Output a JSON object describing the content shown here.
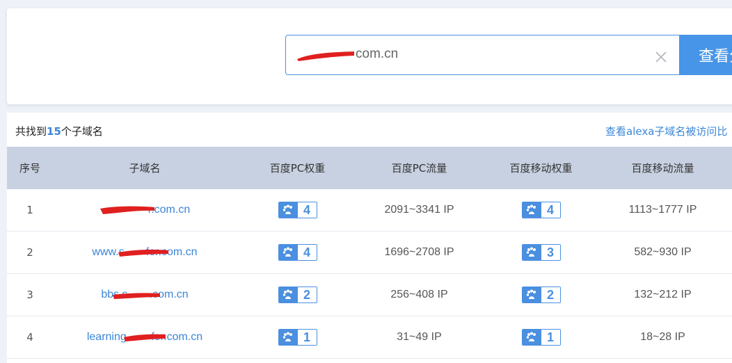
{
  "search": {
    "value": "com.cn",
    "button_label": "查看分"
  },
  "summary": {
    "prefix": "共找到",
    "count": "15",
    "suffix": "个子域名",
    "alexa_link": "查看alexa子域名被访问比"
  },
  "table": {
    "headers": [
      "序号",
      "子域名",
      "百度PC权重",
      "百度PC流量",
      "百度移动权重",
      "百度移动流量"
    ],
    "rows": [
      {
        "index": "1",
        "domain": "r.com.cn",
        "pc_weight": "4",
        "pc_traffic": "2091~3341 IP",
        "mobile_weight": "4",
        "mobile_traffic": "1113~1777 IP"
      },
      {
        "index": "2",
        "domain": "www.s       for.com.cn",
        "pc_weight": "4",
        "pc_traffic": "1696~2708 IP",
        "mobile_weight": "3",
        "mobile_traffic": "582~930 IP"
      },
      {
        "index": "3",
        "domain": "bbs.s       .com.cn",
        "pc_weight": "2",
        "pc_traffic": "256~408 IP",
        "mobile_weight": "2",
        "mobile_traffic": "132~212 IP"
      },
      {
        "index": "4",
        "domain": "learning        for.com.cn",
        "pc_weight": "1",
        "pc_traffic": "31~49 IP",
        "mobile_weight": "1",
        "mobile_traffic": "18~28 IP"
      }
    ]
  },
  "colors": {
    "accent": "#4795e8",
    "link": "#3a86d6",
    "header_bg": "#c8d1e1",
    "redaction": "#e02020"
  },
  "icons": {
    "clear": "close-icon",
    "badge": "baidu-paw-icon"
  }
}
